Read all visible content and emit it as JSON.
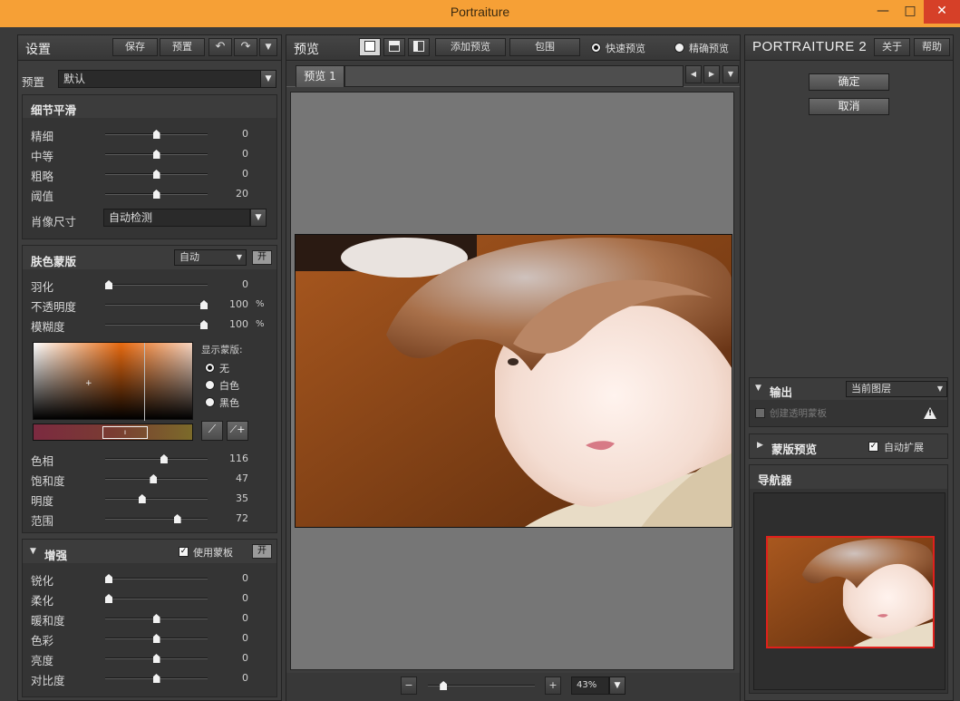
{
  "window": {
    "title": "Portraiture",
    "min_glyph": "—",
    "max_glyph": "□",
    "close_glyph": "✕"
  },
  "left": {
    "header": {
      "title": "设置",
      "save": "保存",
      "preset": "预置"
    },
    "preset_label": "预置",
    "preset_value": "默认",
    "detail": {
      "title": "细节平滑",
      "sliders": [
        {
          "label": "精细",
          "value": 0,
          "level": 0.5
        },
        {
          "label": "中等",
          "value": 0,
          "level": 0.5
        },
        {
          "label": "粗略",
          "value": 0,
          "level": 0.5
        },
        {
          "label": "阈值",
          "value": 20,
          "level": 0.5
        }
      ],
      "portrait_size_label": "肖像尺寸",
      "portrait_size_value": "自动检测"
    },
    "skin": {
      "title": "肤色蒙版",
      "mode": "自动",
      "on_label": "开",
      "sliders": [
        {
          "label": "羽化",
          "value": "0",
          "unit": "",
          "level": 0.0
        },
        {
          "label": "不透明度",
          "value": "100",
          "unit": "%",
          "level": 1.0
        },
        {
          "label": "模糊度",
          "value": "100",
          "unit": "%",
          "level": 1.0
        }
      ],
      "show_mask_label": "显示蒙版:",
      "mask_options": [
        "无",
        "白色",
        "黑色"
      ],
      "selected_mask": 0,
      "hue_sliders": [
        {
          "label": "色相",
          "value": 116,
          "level": 0.58
        },
        {
          "label": "饱和度",
          "value": 47,
          "level": 0.47
        },
        {
          "label": "明度",
          "value": 35,
          "level": 0.35
        },
        {
          "label": "范围",
          "value": 72,
          "level": 0.72
        }
      ]
    },
    "enhance": {
      "title": "增强",
      "use_mask_label": "使用蒙板",
      "use_mask_checked": true,
      "on_label": "开",
      "sliders": [
        {
          "label": "锐化",
          "value": 0,
          "level": 0.0
        },
        {
          "label": "柔化",
          "value": 0,
          "level": 0.0
        },
        {
          "label": "暖和度",
          "value": 0,
          "level": 0.5
        },
        {
          "label": "色彩",
          "value": 0,
          "level": 0.5
        },
        {
          "label": "亮度",
          "value": 0,
          "level": 0.5
        },
        {
          "label": "对比度",
          "value": 0,
          "level": 0.5
        }
      ]
    }
  },
  "center": {
    "header": {
      "title": "预览",
      "add_preview": "添加预览",
      "bracket": "包围",
      "fast_preview": "快速预览",
      "accurate_preview": "精确预览"
    },
    "tab": "预览 1",
    "zoom": "43%",
    "zoom_level": 0.12
  },
  "right": {
    "brand": "PORTRAITURE 2",
    "about": "关于",
    "help": "帮助",
    "ok": "确定",
    "cancel": "取消",
    "output": {
      "title": "输出",
      "value": "当前图层",
      "create_mask_label": "创建透明蒙板",
      "warning_glyph": "!"
    },
    "mask_preview": {
      "title": "蒙版预览",
      "auto_expand_label": "自动扩展",
      "auto_expand_checked": true
    },
    "navigator": {
      "title": "导航器"
    }
  }
}
